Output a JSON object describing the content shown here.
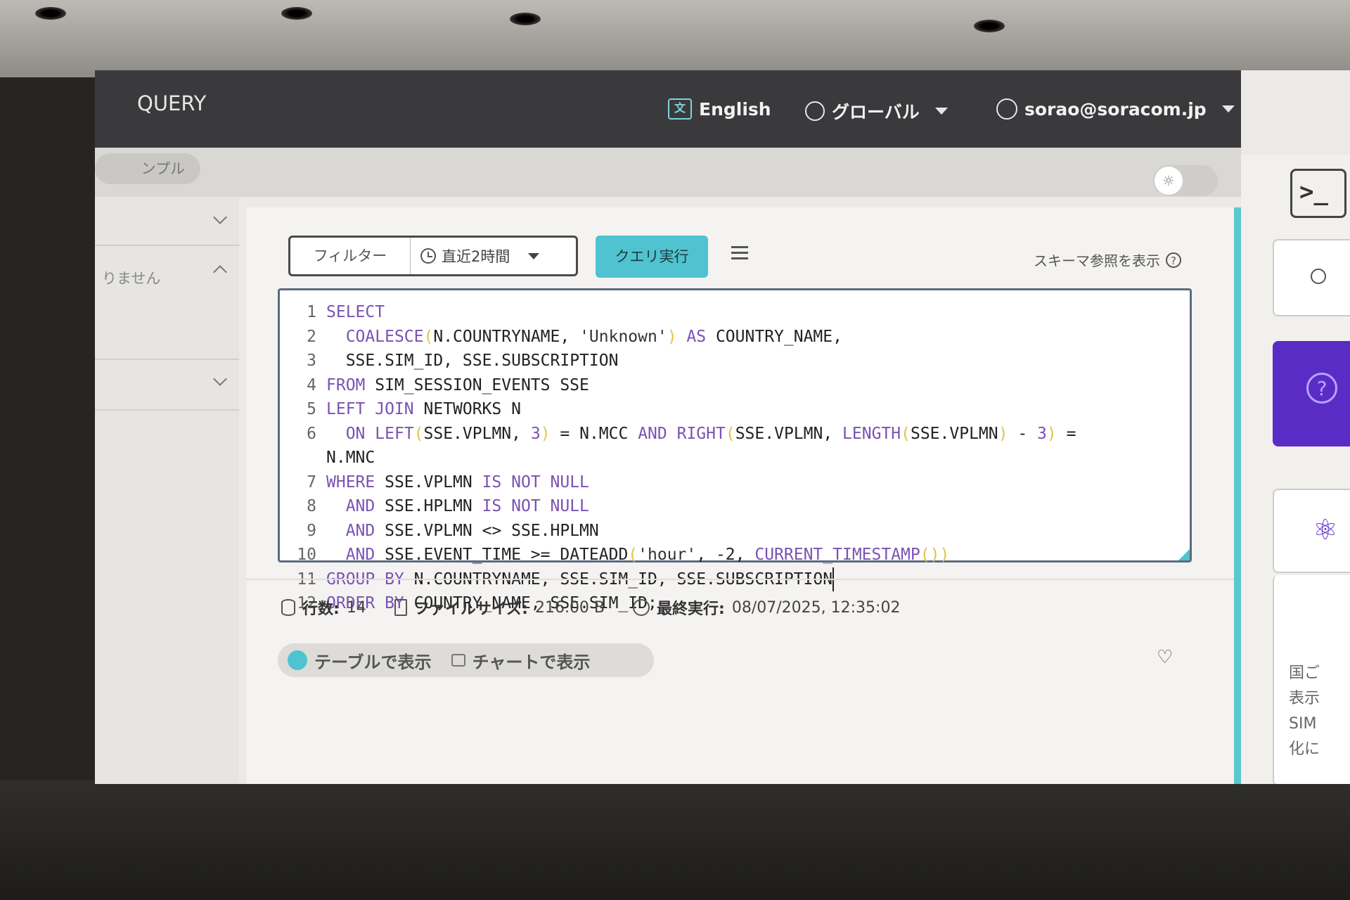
{
  "app": {
    "title": "QUERY"
  },
  "header": {
    "language": "English",
    "region": "グローバル",
    "user": "sorao@soracom.jp"
  },
  "subbar": {
    "sample_label": "ンプル"
  },
  "left_panel": {
    "empty_text": "りません"
  },
  "toolbar": {
    "filter_label": "フィルター",
    "time_range": "直近2時間",
    "run_label": "クエリ実行",
    "schema_link": "スキーマ参照を表示"
  },
  "editor": {
    "lines": [
      {
        "n": "1"
      },
      {
        "n": "2"
      },
      {
        "n": "3"
      },
      {
        "n": "4"
      },
      {
        "n": "5"
      },
      {
        "n": "6"
      },
      {
        "n": ""
      },
      {
        "n": "7"
      },
      {
        "n": "8"
      },
      {
        "n": "9"
      },
      {
        "n": "10"
      },
      {
        "n": "11"
      },
      {
        "n": "12"
      }
    ],
    "tokens": {
      "select": "SELECT",
      "coalesce": "COALESCE",
      "countryname_arg": "N.COUNTRYNAME, ",
      "unknown": "'Unknown'",
      "as": "AS",
      "country_name_alias": " COUNTRY_NAME,",
      "l3": "SSE.SIM_ID, SSE.SUBSCRIPTION",
      "from": "FROM",
      "l4": " SIM_SESSION_EVENTS SSE",
      "left_join": "LEFT JOIN",
      "l5": " NETWORKS N",
      "on": "ON",
      "left_fn": "LEFT",
      "vplmn_arg": "SSE.VPLMN, ",
      "three": "3",
      "eq_mcc": " = N.MCC ",
      "and": "AND",
      "right_fn": "RIGHT",
      "vplmn_comma": "SSE.VPLMN, ",
      "length_fn": "LENGTH",
      "vplmn": "SSE.VPLMN",
      "minus": " - ",
      "eq": " =",
      "mnc": "N.MNC",
      "where": "WHERE",
      "l7_vplmn": " SSE.VPLMN ",
      "is_not_null": "IS NOT NULL",
      "l8_hplmn": " SSE.HPLMN ",
      "l9": " SSE.VPLMN <> SSE.HPLMN",
      "l10_a": " SSE.EVENT_TIME >= ",
      "dateadd": "DATEADD",
      "hour": "'hour'",
      "l10_b": ", -2, ",
      "current_ts": "CURRENT_TIMESTAMP",
      "group_by": "GROUP BY",
      "l11": " N.COUNTRYNAME, SSE.SIM_ID, SSE.SUBSCRIPTION",
      "order_by": "ORDER BY",
      "l12": " COUNTRY_NAME, SSE.SIM_ID;"
    }
  },
  "stats": {
    "rows_label": "行数:",
    "rows_value": "14",
    "size_label": "ファイルサイズ:",
    "size_value": "216.00 B",
    "last_run_label": "最終実行:",
    "last_run_value": "08/07/2025, 12:35:02"
  },
  "view": {
    "table_label": "テーブルで表示",
    "chart_label": "チャートで表示",
    "active": "table"
  },
  "right_rail": {
    "terminal_glyph": ">_",
    "description_lines": [
      "国ご",
      "表示",
      "SIM",
      "化に"
    ]
  },
  "colors": {
    "accent": "#4fc3cf",
    "brand": "#5a2cc6",
    "header": "#3a3a3c"
  }
}
